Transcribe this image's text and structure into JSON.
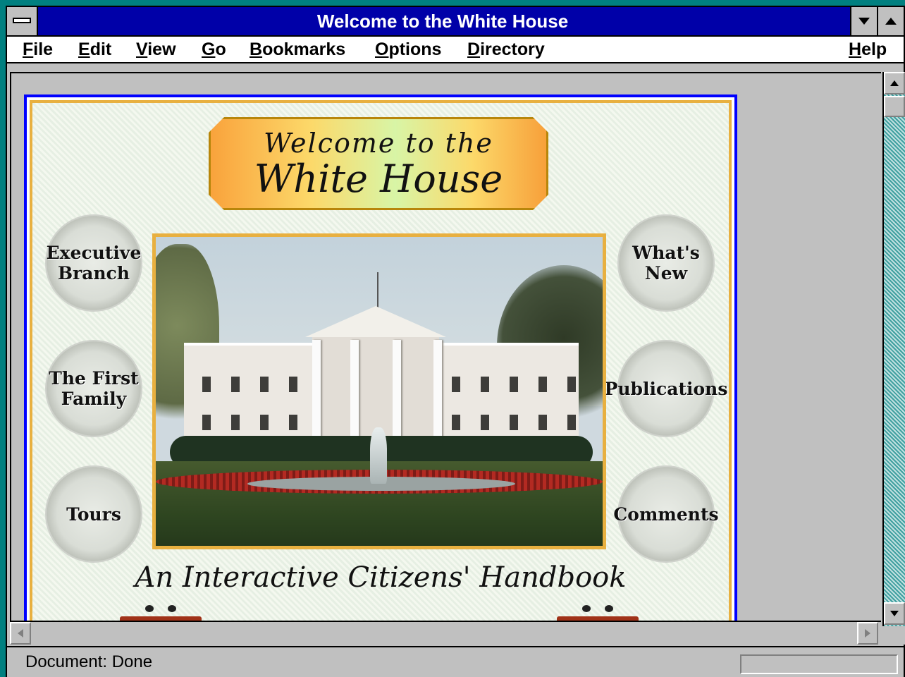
{
  "window": {
    "title": "Welcome to the White House"
  },
  "menu": {
    "items": [
      {
        "label": "File",
        "accel": "F",
        "rest": "ile"
      },
      {
        "label": "Edit",
        "accel": "E",
        "rest": "dit"
      },
      {
        "label": "View",
        "accel": "V",
        "rest": "iew"
      },
      {
        "label": "Go",
        "accel": "G",
        "rest": "o"
      },
      {
        "label": "Bookmarks",
        "accel": "B",
        "rest": "ookmarks"
      },
      {
        "label": "Options",
        "accel": "O",
        "rest": "ptions"
      },
      {
        "label": "Directory",
        "accel": "D",
        "rest": "irectory"
      },
      {
        "label": "Help",
        "accel": "H",
        "rest": "elp"
      }
    ]
  },
  "page": {
    "banner_line1": "Welcome to the",
    "banner_line2": "White House",
    "subtitle": "An Interactive Citizens' Handbook",
    "links": {
      "executive_line1": "Executive",
      "executive_line2": "Branch",
      "first_family_line1": "The First",
      "first_family_line2": "Family",
      "tours": "Tours",
      "whats_new_line1": "What's",
      "whats_new_line2": "New",
      "publications": "Publications",
      "comments": "Comments"
    }
  },
  "status": {
    "text": "Document: Done"
  },
  "colors": {
    "titlebar": "#0000a8",
    "page_border": "#0000ff",
    "frame_gold": "#e8b040"
  }
}
